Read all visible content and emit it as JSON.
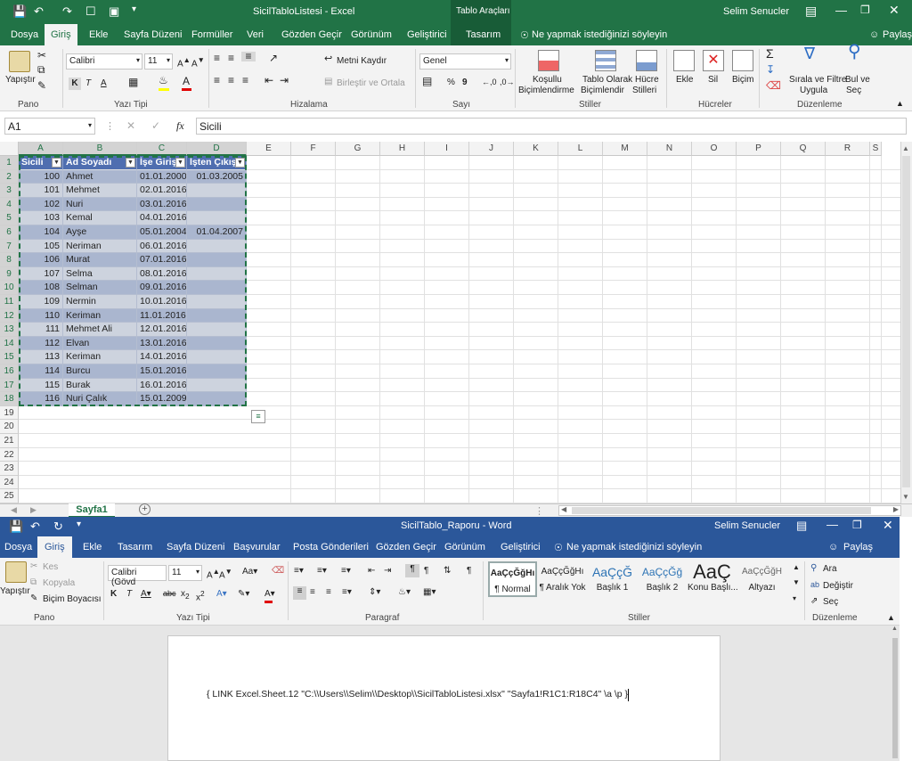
{
  "excel": {
    "title": "SicilTabloListesi - Excel",
    "tools_title": "Tablo Araçları",
    "user": "Selim Senucler",
    "tabs": [
      "Dosya",
      "Giriş",
      "Ekle",
      "Sayfa Düzeni",
      "Formüller",
      "Veri",
      "Gözden Geçir",
      "Görünüm",
      "Geliştirici",
      "Tasarım"
    ],
    "tellme": "Ne yapmak istediğinizi söyleyin",
    "share": "Paylaş",
    "ribbon": {
      "paste": "Yapıştır",
      "clipboard_group": "Pano",
      "font_name": "Calibri",
      "font_size": "11",
      "font_group": "Yazı Tipi",
      "wrap_text": "Metni Kaydır",
      "merge_center": "Birleştir ve Ortala",
      "alignment_group": "Hizalama",
      "number_format": "Genel",
      "number_group": "Sayı",
      "cond_format_1": "Koşullu",
      "cond_format_2": "Biçimlendirme",
      "format_table_1": "Tablo Olarak",
      "format_table_2": "Biçimlendir",
      "cell_styles_1": "Hücre",
      "cell_styles_2": "Stilleri",
      "styles_group": "Stiller",
      "insert": "Ekle",
      "delete": "Sil",
      "format": "Biçim",
      "cells_group": "Hücreler",
      "sort_filter_1": "Sırala ve Filtre",
      "sort_filter_2": "Uygula",
      "find_select_1": "Bul ve",
      "find_select_2": "Seç",
      "editing_group": "Düzenleme",
      "bold": "K",
      "italic": "T",
      "underline": "A",
      "percent": "%",
      "comma": "9"
    },
    "name_box": "A1",
    "formula": "Sicili",
    "fx": "fx",
    "columns": [
      "A",
      "B",
      "C",
      "D",
      "E",
      "F",
      "G",
      "H",
      "I",
      "J",
      "K",
      "L",
      "M",
      "N",
      "O",
      "P",
      "Q",
      "R",
      "S"
    ],
    "row_numbers": [
      "1",
      "2",
      "3",
      "4",
      "5",
      "6",
      "7",
      "8",
      "9",
      "10",
      "11",
      "12",
      "13",
      "14",
      "15",
      "16",
      "17",
      "18",
      "19",
      "20",
      "21",
      "22",
      "23",
      "24",
      "25"
    ],
    "table_headers": [
      "Sicili",
      "Ad Soyadı",
      "İşe Giriş",
      "İşten Çıkış"
    ],
    "rows": [
      [
        "100",
        "Ahmet",
        "01.01.2000",
        "01.03.2005"
      ],
      [
        "101",
        "Mehmet",
        "02.01.2016",
        ""
      ],
      [
        "102",
        "Nuri",
        "03.01.2016",
        ""
      ],
      [
        "103",
        "Kemal",
        "04.01.2016",
        ""
      ],
      [
        "104",
        "Ayşe",
        "05.01.2004",
        "01.04.2007"
      ],
      [
        "105",
        "Neriman",
        "06.01.2016",
        ""
      ],
      [
        "106",
        "Murat",
        "07.01.2016",
        ""
      ],
      [
        "107",
        "Selma",
        "08.01.2016",
        ""
      ],
      [
        "108",
        "Selman",
        "09.01.2016",
        ""
      ],
      [
        "109",
        "Nermin",
        "10.01.2016",
        ""
      ],
      [
        "110",
        "Keriman",
        "11.01.2016",
        ""
      ],
      [
        "111",
        "Mehmet Ali",
        "12.01.2016",
        ""
      ],
      [
        "112",
        "Elvan",
        "13.01.2016",
        ""
      ],
      [
        "113",
        "Keriman",
        "14.01.2016",
        ""
      ],
      [
        "114",
        "Burcu",
        "15.01.2016",
        ""
      ],
      [
        "115",
        "Burak",
        "16.01.2016",
        ""
      ],
      [
        "116",
        "Nuri Çalık",
        "15.01.2009",
        ""
      ]
    ],
    "sheet_tab": "Sayfa1",
    "colors": {
      "accent": "#217346",
      "table_header": "#4f6eb0",
      "band_dark": "#aab6cf",
      "band_light": "#cdd3de"
    }
  },
  "word": {
    "title": "SicilTablo_Raporu - Word",
    "user": "Selim Senucler",
    "tabs": [
      "Dosya",
      "Giriş",
      "Ekle",
      "Tasarım",
      "Sayfa Düzeni",
      "Başvurular",
      "Posta Gönderileri",
      "Gözden Geçir",
      "Görünüm",
      "Geliştirici"
    ],
    "tellme": "Ne yapmak istediğinizi söyleyin",
    "share": "Paylaş",
    "ribbon": {
      "paste": "Yapıştır",
      "cut": "Kes",
      "copy": "Kopyala",
      "format_painter": "Biçim Boyacısı",
      "clipboard_group": "Pano",
      "font_name": "Calibri (Gövd",
      "font_size": "11",
      "font_group": "Yazı Tipi",
      "paragraph_group": "Paragraf",
      "styles_group": "Stiller",
      "find": "Ara",
      "replace": "Değiştir",
      "select": "Seç",
      "editing_group": "Düzenleme"
    },
    "styles": [
      {
        "preview": "AaÇçĞğHı",
        "label": "¶ Normal"
      },
      {
        "preview": "AaÇçĞğHı",
        "label": "¶ Aralık Yok"
      },
      {
        "preview": "AaÇçĞ",
        "label": "Başlık 1"
      },
      {
        "preview": "AaÇçĞğ",
        "label": "Başlık 2"
      },
      {
        "preview": "AaÇ",
        "label": "Konu Başlı..."
      },
      {
        "preview": "AaÇçĞğH",
        "label": "Altyazı"
      }
    ],
    "field_code": "{ LINK Excel.Sheet.12 \"C:\\\\Users\\\\Selim\\\\Desktop\\\\SicilTabloListesi.xlsx\" \"Sayfa1!R1C1:R18C4\" \\a \\p }",
    "colors": {
      "accent": "#2b579a"
    }
  }
}
